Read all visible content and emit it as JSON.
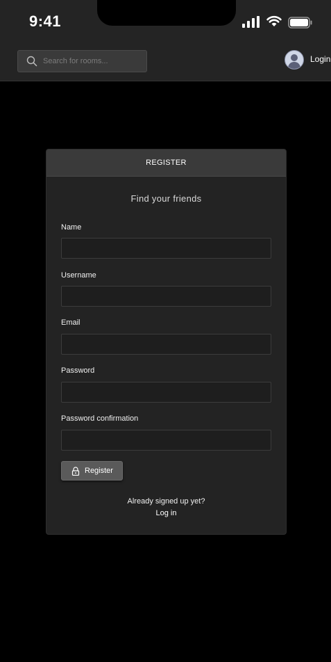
{
  "status_bar": {
    "time": "9:41",
    "icons": [
      "signal-icon",
      "wifi-icon",
      "battery-icon"
    ]
  },
  "header": {
    "search": {
      "placeholder": "Search for rooms...",
      "icon": "search-icon"
    },
    "avatar_icon": "user-avatar-icon",
    "login_label": "Login"
  },
  "card": {
    "title": "REGISTER",
    "subtitle": "Find your friends",
    "fields": [
      {
        "label": "Name",
        "value": ""
      },
      {
        "label": "Username",
        "value": ""
      },
      {
        "label": "Email",
        "value": ""
      },
      {
        "label": "Password",
        "value": ""
      },
      {
        "label": "Password confirmation",
        "value": ""
      }
    ],
    "submit_label": "Register",
    "submit_icon": "lock-icon",
    "already_text": "Already signed up yet?",
    "login_link": "Log in"
  },
  "colors": {
    "background": "#000000",
    "header_bg": "#242424",
    "card_bg": "#232323",
    "card_header_bg": "#3a3a3a",
    "button_bg": "#5a5a5a"
  }
}
